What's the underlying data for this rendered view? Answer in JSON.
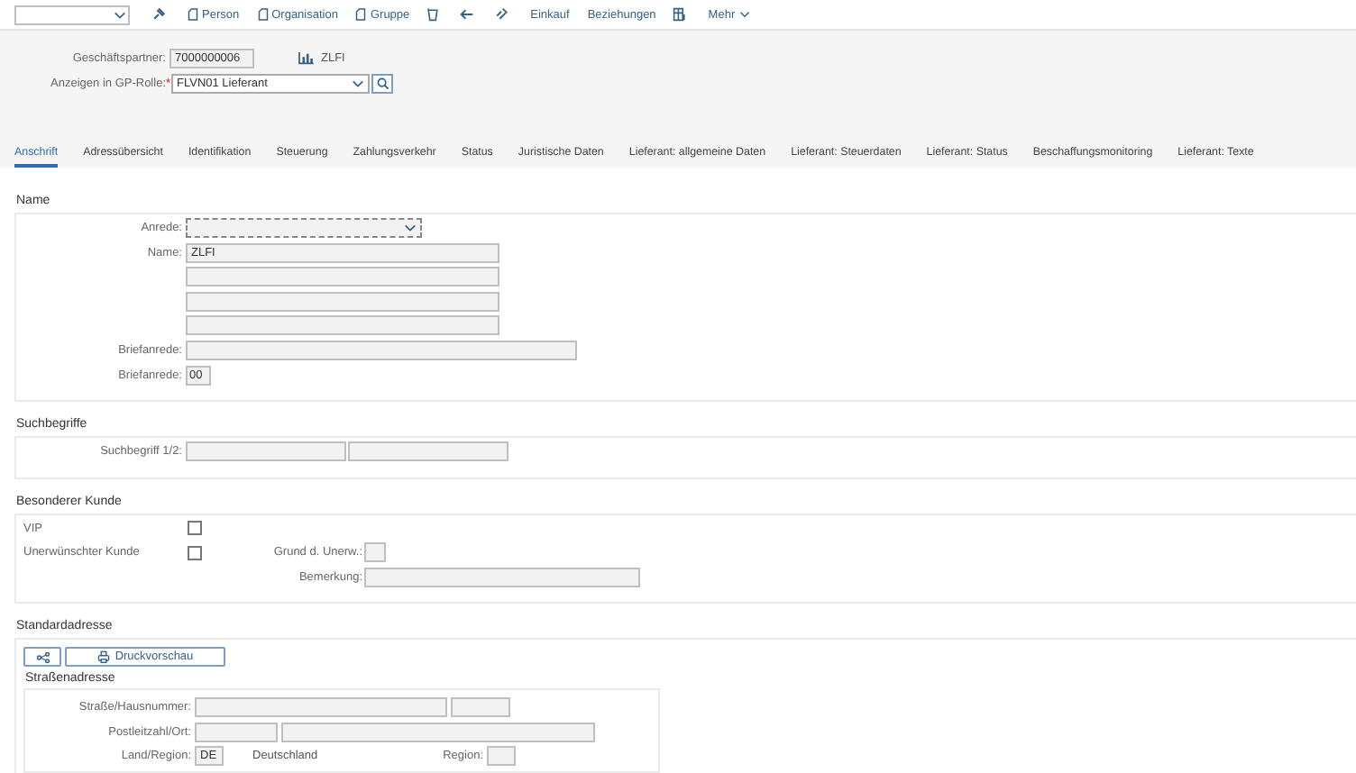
{
  "toolbar": {
    "items": [
      {
        "kind": "icon"
      },
      {
        "kind": "doc",
        "label": "Person"
      },
      {
        "kind": "doc",
        "label": "Organisation"
      },
      {
        "kind": "doc",
        "label": "Gruppe"
      },
      {
        "kind": "icon"
      },
      {
        "kind": "icon"
      },
      {
        "kind": "icon"
      },
      {
        "kind": "text",
        "label": "Einkauf"
      },
      {
        "kind": "text",
        "label": "Beziehungen"
      },
      {
        "kind": "icon"
      },
      {
        "kind": "menu",
        "label": "Mehr"
      }
    ]
  },
  "header": {
    "partner_label": "Geschäftspartner:",
    "partner_value": "7000000006",
    "partner_name": "ZLFI",
    "role_label": "Anzeigen in GP-Rolle:",
    "role_required": "*",
    "role_value": "FLVN01 Lieferant"
  },
  "tabs": [
    {
      "label": "Anschrift",
      "selected": true
    },
    {
      "label": "Adressübersicht",
      "selected": false
    },
    {
      "label": "Identifikation",
      "selected": false
    },
    {
      "label": "Steuerung",
      "selected": false
    },
    {
      "label": "Zahlungsverkehr",
      "selected": false
    },
    {
      "label": "Status",
      "selected": false
    },
    {
      "label": "Juristische Daten",
      "selected": false
    },
    {
      "label": "Lieferant: allgemeine Daten",
      "selected": false
    },
    {
      "label": "Lieferant: Steuerdaten",
      "selected": false
    },
    {
      "label": "Lieferant: Status",
      "selected": false
    },
    {
      "label": "Beschaffungsmonitoring",
      "selected": false
    },
    {
      "label": "Lieferant: Texte",
      "selected": false
    }
  ],
  "name_section": {
    "title": "Name",
    "salutation_label": "Anrede:",
    "name_label": "Name:",
    "name_value": "ZLFI",
    "letter_label": "Briefanrede:",
    "letter_label_2": "Briefanrede:",
    "letter_code": "00"
  },
  "search_section": {
    "title": "Suchbegriffe",
    "label": "Suchbegriff 1/2:"
  },
  "special_section": {
    "title": "Besonderer Kunde",
    "vip_label": "VIP",
    "vip_checked": false,
    "unwanted_label": "Unerwünschter Kunde",
    "unwanted_checked": false,
    "reason_label": "Grund d. Unerw.:",
    "remark_label": "Bemerkung:"
  },
  "address_section": {
    "title": "Standardadresse",
    "print_button": "Druckvorschau",
    "sub_title": "Straßenadresse",
    "street_label": "Straße/Hausnummer:",
    "postal_label": "Postleitzahl/Ort:",
    "country_label": "Land/Region:",
    "country_code": "DE",
    "country_name": "Deutschland",
    "region_label": "Region:"
  }
}
